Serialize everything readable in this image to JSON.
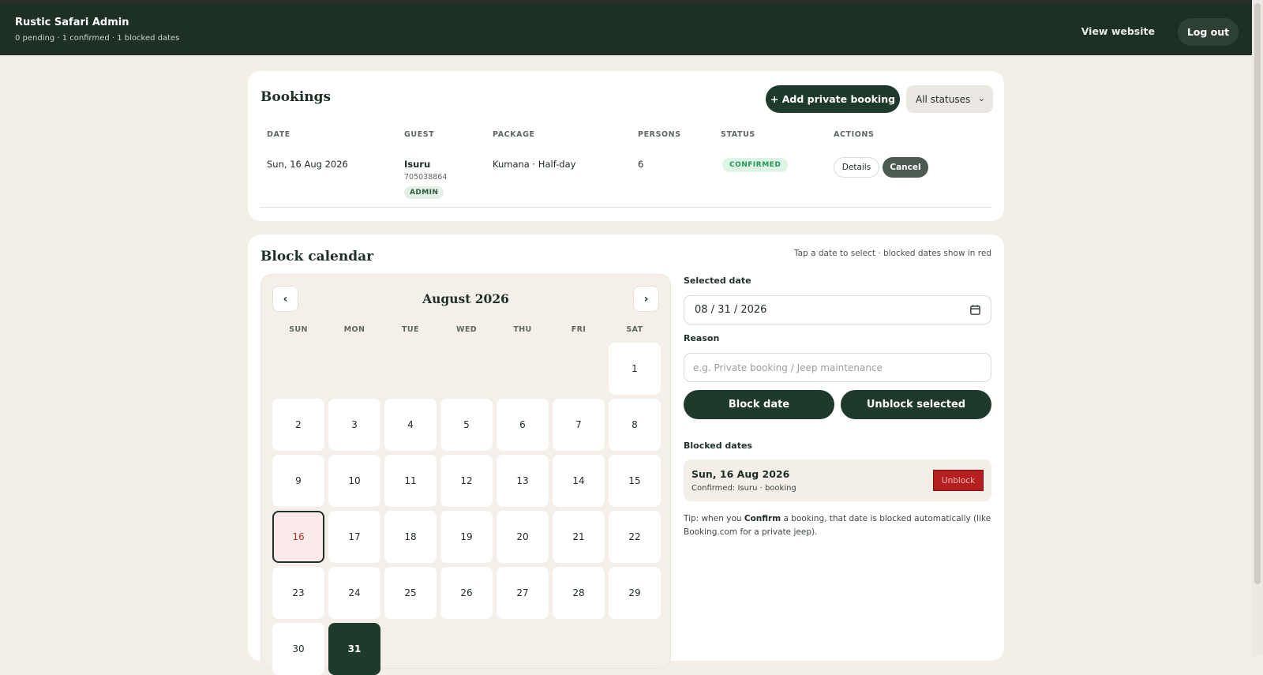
{
  "header": {
    "title": "Rustic Safari Admin",
    "summary": "0 pending · 1 confirmed · 1 blocked dates",
    "view_website": "View website",
    "logout": "Log out"
  },
  "bookings": {
    "title": "Bookings",
    "add_button": "+ Add private booking",
    "status_filter": "All statuses",
    "columns": [
      "DATE",
      "GUEST",
      "PACKAGE",
      "PERSONS",
      "STATUS",
      "ACTIONS"
    ],
    "rows": [
      {
        "date": "Sun, 16 Aug 2026",
        "guest_name": "Isuru",
        "guest_phone": "705038864",
        "guest_badge": "ADMIN",
        "package": "Kumana · Half-day",
        "persons": "6",
        "status": "CONFIRMED",
        "details_label": "Details",
        "cancel_label": "Cancel"
      }
    ]
  },
  "block_calendar": {
    "title": "Block calendar",
    "hint": "Tap a date to select · blocked dates show in red",
    "month_label": "August 2026",
    "prev_icon": "chevron-left-icon",
    "next_icon": "chevron-right-icon",
    "weekdays": [
      "SUN",
      "MON",
      "TUE",
      "WED",
      "THU",
      "FRI",
      "SAT"
    ],
    "first_weekday_index": 6,
    "days_in_month": 31,
    "blocked_days": [
      16
    ],
    "selected_day": 31,
    "selected_date_label": "Selected date",
    "selected_date_value": "08 / 31 / 2026",
    "reason_label": "Reason",
    "reason_placeholder": "e.g. Private booking / Jeep maintenance",
    "block_button": "Block date",
    "unblock_selected_button": "Unblock selected",
    "blocked_dates_label": "Blocked dates",
    "blocked_dates": [
      {
        "date": "Sun, 16 Aug 2026",
        "note": "Confirmed: Isuru · booking",
        "unblock_label": "Unblock"
      }
    ],
    "tip_prefix": "Tip: when you ",
    "tip_bold": "Confirm",
    "tip_suffix": " a booking, that date is blocked automatically (like Booking.com for a private jeep)."
  },
  "colors": {
    "header_bg": "#1e2f26",
    "primary": "#1e3a2c",
    "page_bg": "#f3efe7",
    "confirmed": "#259657",
    "blocked_red": "#b51f1f"
  }
}
